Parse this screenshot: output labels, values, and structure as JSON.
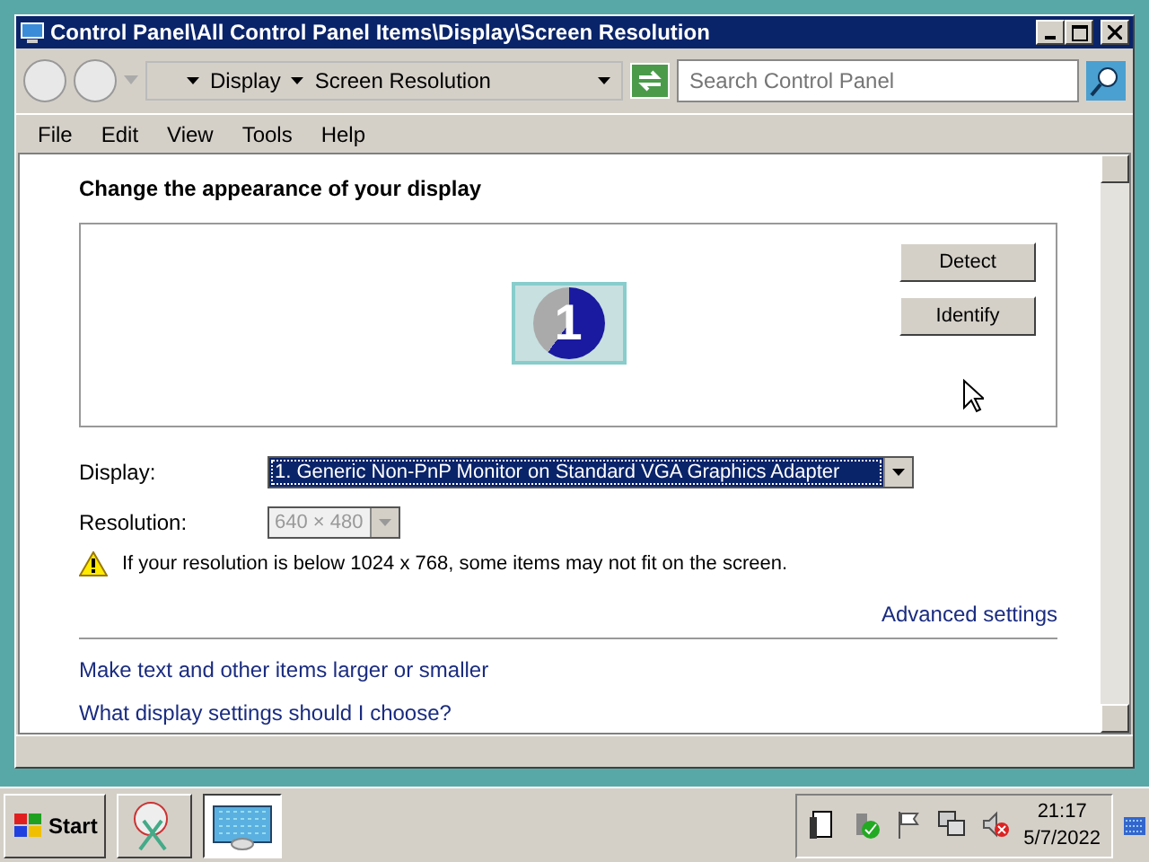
{
  "window": {
    "title": "Control Panel\\All Control Panel Items\\Display\\Screen Resolution"
  },
  "address_bar": {
    "breadcrumbs": [
      "Display",
      "Screen Resolution"
    ]
  },
  "search": {
    "placeholder": "Search Control Panel"
  },
  "menu": [
    "File",
    "Edit",
    "View",
    "Tools",
    "Help"
  ],
  "heading": "Change the appearance of your display",
  "monitor": {
    "number": "1"
  },
  "buttons": [
    "Detect",
    "Identify"
  ],
  "fields": [
    {
      "label": "Display:",
      "value": "1. Generic Non-PnP Monitor on Standard VGA Graphics Adapter",
      "focused": true,
      "disabled": false
    },
    {
      "label": "Resolution:",
      "value": "640 × 480",
      "focused": false,
      "disabled": true
    }
  ],
  "warning": "If your resolution is below 1024 x 768, some items may not fit on the screen.",
  "advanced_link": "Advanced settings",
  "links": [
    "Make text and other items larger or smaller",
    "What display settings should I choose?"
  ],
  "taskbar": {
    "start": "Start",
    "time": "21:17",
    "date": "5/7/2022"
  }
}
